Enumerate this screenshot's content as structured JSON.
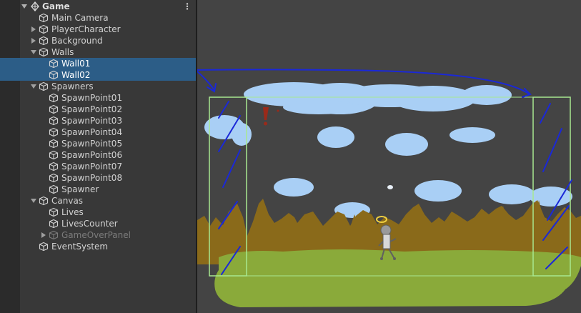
{
  "hierarchy": {
    "scene_name": "Game",
    "items": [
      {
        "label": "Main Camera",
        "depth": 1,
        "expand": "none",
        "selected": false,
        "dimmed": false
      },
      {
        "label": "PlayerCharacter",
        "depth": 1,
        "expand": "collapsed",
        "selected": false,
        "dimmed": false
      },
      {
        "label": "Background",
        "depth": 1,
        "expand": "collapsed",
        "selected": false,
        "dimmed": false
      },
      {
        "label": "Walls",
        "depth": 1,
        "expand": "expanded",
        "selected": false,
        "dimmed": false
      },
      {
        "label": "Wall01",
        "depth": 2,
        "expand": "none",
        "selected": true,
        "dimmed": false
      },
      {
        "label": "Wall02",
        "depth": 2,
        "expand": "none",
        "selected": true,
        "dimmed": false
      },
      {
        "label": "Spawners",
        "depth": 1,
        "expand": "expanded",
        "selected": false,
        "dimmed": false
      },
      {
        "label": "SpawnPoint01",
        "depth": 2,
        "expand": "none",
        "selected": false,
        "dimmed": false
      },
      {
        "label": "SpawnPoint02",
        "depth": 2,
        "expand": "none",
        "selected": false,
        "dimmed": false
      },
      {
        "label": "SpawnPoint03",
        "depth": 2,
        "expand": "none",
        "selected": false,
        "dimmed": false
      },
      {
        "label": "SpawnPoint04",
        "depth": 2,
        "expand": "none",
        "selected": false,
        "dimmed": false
      },
      {
        "label": "SpawnPoint05",
        "depth": 2,
        "expand": "none",
        "selected": false,
        "dimmed": false
      },
      {
        "label": "SpawnPoint06",
        "depth": 2,
        "expand": "none",
        "selected": false,
        "dimmed": false
      },
      {
        "label": "SpawnPoint07",
        "depth": 2,
        "expand": "none",
        "selected": false,
        "dimmed": false
      },
      {
        "label": "SpawnPoint08",
        "depth": 2,
        "expand": "none",
        "selected": false,
        "dimmed": false
      },
      {
        "label": "Spawner",
        "depth": 2,
        "expand": "none",
        "selected": false,
        "dimmed": false
      },
      {
        "label": "Canvas",
        "depth": 1,
        "expand": "expanded",
        "selected": false,
        "dimmed": false
      },
      {
        "label": "Lives",
        "depth": 2,
        "expand": "none",
        "selected": false,
        "dimmed": false
      },
      {
        "label": "LivesCounter",
        "depth": 2,
        "expand": "none",
        "selected": false,
        "dimmed": false
      },
      {
        "label": "GameOverPanel",
        "depth": 2,
        "expand": "collapsed",
        "selected": false,
        "dimmed": true
      },
      {
        "label": "EventSystem",
        "depth": 1,
        "expand": "none",
        "selected": false,
        "dimmed": false
      }
    ]
  },
  "colors": {
    "selection": "#2c5d87",
    "panel_bg": "#383838",
    "scene_bg": "#444444",
    "sky_cloud": "#a9cff5",
    "mountains": "#8a6a1a",
    "grass": "#8aaa3a",
    "wall_outline": "#a8e890",
    "annotation_ink": "#1a28d8"
  }
}
